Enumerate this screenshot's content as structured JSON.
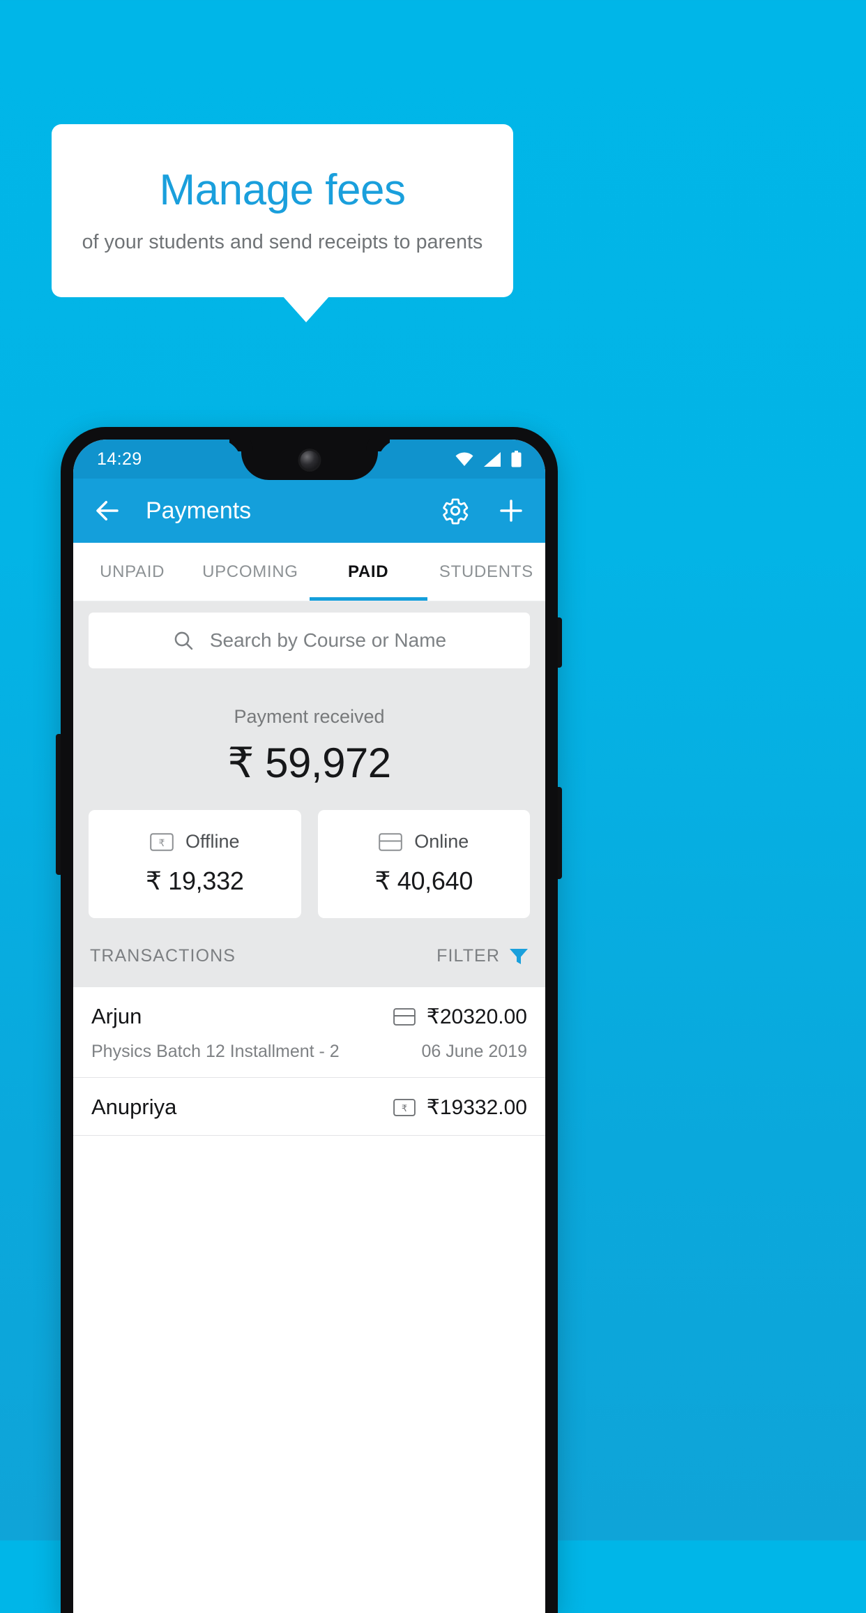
{
  "promo": {
    "title": "Manage fees",
    "subtitle": "of your students and send receipts to parents",
    "title_color": "#1a9fdc",
    "background_color": "#00b6e8"
  },
  "phone": {
    "statusbar": {
      "time": "14:29",
      "icons": [
        "wifi-icon",
        "signal-icon",
        "battery-icon"
      ]
    },
    "appbar": {
      "back_icon": "back-arrow-icon",
      "title": "Payments",
      "settings_icon": "gear-icon",
      "add_icon": "plus-icon",
      "color": "#149fdb"
    },
    "tabs": [
      {
        "label": "UNPAID",
        "active": false
      },
      {
        "label": "UPCOMING",
        "active": false
      },
      {
        "label": "PAID",
        "active": true
      },
      {
        "label": "STUDENTS",
        "active": false
      }
    ],
    "search": {
      "icon": "search-icon",
      "placeholder": "Search by Course or Name",
      "value": ""
    },
    "summary": {
      "label": "Payment received",
      "amount": "₹ 59,972",
      "breakdown": [
        {
          "icon": "rupee-note-icon",
          "label": "Offline",
          "amount": "₹ 19,332"
        },
        {
          "icon": "credit-card-icon",
          "label": "Online",
          "amount": "₹ 40,640"
        }
      ]
    },
    "transactions_header": {
      "title": "TRANSACTIONS",
      "filter_label": "FILTER",
      "filter_icon": "funnel-icon"
    },
    "transactions": [
      {
        "name": "Arjun",
        "description": "Physics Batch 12 Installment - 2",
        "amount": "₹20320.00",
        "date": "06 June 2019",
        "method_icon": "credit-card-icon"
      },
      {
        "name": "Anupriya",
        "description": "",
        "amount": "₹19332.00",
        "date": "",
        "method_icon": "rupee-note-icon"
      }
    ]
  }
}
